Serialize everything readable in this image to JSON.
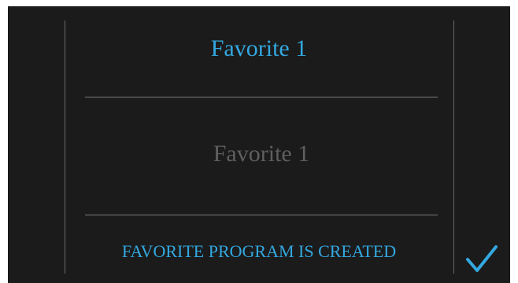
{
  "header": {
    "title": "Favorite 1"
  },
  "name_field": {
    "value": "Favorite 1"
  },
  "status": {
    "message": "FAVORITE PROGRAM IS CREATED"
  },
  "confirm": {
    "icon": "checkmark-icon"
  },
  "colors": {
    "accent": "#33a8e0",
    "background": "#1b1b1b",
    "muted_text": "#5f5f5f",
    "divider": "#7a7a7a"
  }
}
